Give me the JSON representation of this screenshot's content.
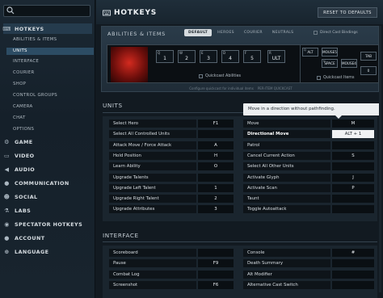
{
  "sidebar": {
    "search_placeholder": "",
    "hotkeys_label": "HOTKEYS",
    "sub_items": [
      "ABILITIES & ITEMS",
      "UNITS",
      "INTERFACE",
      "COURIER",
      "SHOP",
      "CONTROL GROUPS",
      "CAMERA",
      "CHAT",
      "OPTIONS"
    ],
    "sections": [
      "GAME",
      "VIDEO",
      "AUDIO",
      "COMMUNICATION",
      "SOCIAL",
      "LABS",
      "SPECTATOR HOTKEYS",
      "ACCOUNT",
      "LANGUAGE"
    ]
  },
  "header": {
    "title": "HOTKEYS",
    "reset_label": "RESET TO DEFAULTS"
  },
  "abilities": {
    "title": "ABILITIES & ITEMS",
    "tabs": [
      "DEFAULT",
      "HEROES",
      "COURIER",
      "NEUTRALS"
    ],
    "direct_cast": "Direct Cast Bindings",
    "ability_keys": [
      {
        "mod": "Q",
        "key": "1"
      },
      {
        "mod": "W",
        "key": "2"
      },
      {
        "mod": "E",
        "key": "3"
      },
      {
        "mod": "D",
        "key": "4"
      },
      {
        "mod": "F",
        "key": "5"
      },
      {
        "mod": "R",
        "key": "ULT"
      }
    ],
    "quickcast_abilities": "Quickcast Abilities",
    "quickcast_items": "Quickcast Items",
    "item_keys": [
      {
        "mod": "Q",
        "key": "ALT"
      },
      {
        "mod": "",
        "key": "MOUSE5"
      },
      {
        "mod": "",
        "key": "TAB"
      },
      {
        "mod": "V",
        "key": "SPACE"
      },
      {
        "mod": "",
        "key": "MOUSE4"
      },
      {
        "mod": "",
        "key": "0"
      }
    ],
    "hint_left": "Configure quickcast for individual items",
    "hint_right": "PER-ITEM QUICKCAST"
  },
  "units": {
    "title": "UNITS",
    "left": [
      {
        "label": "Select Hero",
        "key": "F1"
      },
      {
        "label": "Select All Controlled Units",
        "key": ""
      },
      {
        "label": "Attack Move / Force Attack",
        "key": "A"
      },
      {
        "label": "Hold Position",
        "key": "H"
      },
      {
        "label": "Learn Ability",
        "key": "O"
      },
      {
        "label": "Upgrade Talents",
        "key": ""
      },
      {
        "label": "Upgrade Left Talent",
        "key": "1"
      },
      {
        "label": "Upgrade Right Talent",
        "key": "2"
      },
      {
        "label": "Upgrade Attributes",
        "key": "3"
      }
    ],
    "right": [
      {
        "label": "Move",
        "key": "M"
      },
      {
        "label": "Directional Move",
        "key": "ALT + 1"
      },
      {
        "label": "Patrol",
        "key": ""
      },
      {
        "label": "Cancel Current Action",
        "key": "S"
      },
      {
        "label": "Select All Other Units",
        "key": ""
      },
      {
        "label": "Activate Glyph",
        "key": "J"
      },
      {
        "label": "Activate Scan",
        "key": "P"
      },
      {
        "label": "Taunt",
        "key": ""
      },
      {
        "label": "Toggle Autoattack",
        "key": ""
      }
    ],
    "tooltip": "Move in a direction without pathfinding."
  },
  "interface": {
    "title": "INTERFACE",
    "left": [
      {
        "label": "Scoreboard",
        "key": ""
      },
      {
        "label": "Pause",
        "key": "F9"
      },
      {
        "label": "Combat Log",
        "key": ""
      },
      {
        "label": "Screenshot",
        "key": "F6"
      }
    ],
    "right": [
      {
        "label": "Console",
        "key": "#"
      },
      {
        "label": "Death Summary",
        "key": ""
      },
      {
        "label": "Alt Modifier",
        "key": ""
      },
      {
        "label": "Alternative Cast Switch",
        "key": ""
      }
    ]
  }
}
